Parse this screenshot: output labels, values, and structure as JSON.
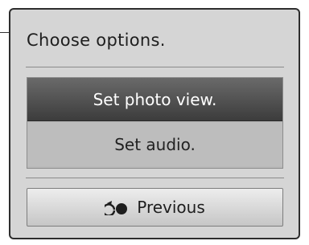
{
  "dialog": {
    "title": "Choose options."
  },
  "options": [
    {
      "label": "Set photo view.",
      "selected": true
    },
    {
      "label": "Set audio.",
      "selected": false
    }
  ],
  "previous_button": {
    "label": "Previous",
    "icon": "back-return-icon"
  },
  "colors": {
    "dialog_background": "#d5d5d5",
    "selected_option": "#4f4f4f",
    "option_background": "#bdbdbd",
    "border": "#2d2d2d"
  }
}
